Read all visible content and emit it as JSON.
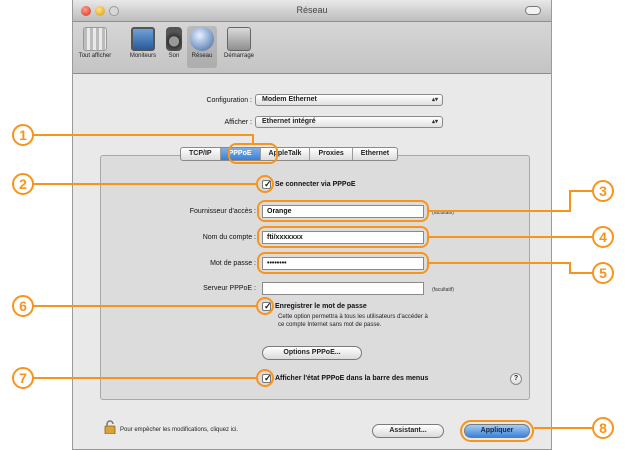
{
  "window": {
    "title": "Réseau"
  },
  "toolbar": {
    "items": [
      {
        "label": "Tout afficher",
        "icon": "grid-icon"
      },
      {
        "label": "Moniteurs",
        "icon": "monitor-icon"
      },
      {
        "label": "Son",
        "icon": "speaker-icon"
      },
      {
        "label": "Réseau",
        "icon": "network-globe-icon"
      },
      {
        "label": "Démarrage",
        "icon": "disk-icon"
      }
    ]
  },
  "configuration": {
    "label": "Configuration :",
    "value": "Modem Ethernet"
  },
  "afficher": {
    "label": "Afficher :",
    "value": "Ethernet intégré"
  },
  "tabs": [
    "TCP/IP",
    "PPPoE",
    "AppleTalk",
    "Proxies",
    "Ethernet"
  ],
  "selected_tab": "PPPoE",
  "pppoe": {
    "connect_label": "Se connecter via PPPoE",
    "connect_checked": true,
    "provider_label": "Fournisseur d'accès :",
    "provider_value": "Orange",
    "provider_hint": "(facultatif)",
    "account_label": "Nom du compte :",
    "account_value": "fti/xxxxxxx",
    "password_label": "Mot de passe :",
    "password_value": "••••••••",
    "server_label": "Serveur PPPoE :",
    "server_value": "",
    "server_hint": "(facultatif)",
    "save_password_label": "Enregistrer le mot de passe",
    "save_password_checked": true,
    "save_password_note_1": "Cette option permettra à tous les utilisateurs d'accéder à",
    "save_password_note_2": "ce compte Internet sans mot de passe.",
    "options_button": "Options PPPoE...",
    "show_status_label": "Afficher l'état PPPoE dans la barre des menus",
    "show_status_checked": true,
    "help": "?"
  },
  "footer": {
    "lock_message": "Pour empêcher les modifications, cliquez ici.",
    "assistant_button": "Assistant...",
    "apply_button": "Appliquer"
  },
  "callouts": [
    "1",
    "2",
    "3",
    "4",
    "5",
    "6",
    "7",
    "8"
  ],
  "colors": {
    "callout": "#f7941d",
    "selection": "#3b7fd4"
  }
}
